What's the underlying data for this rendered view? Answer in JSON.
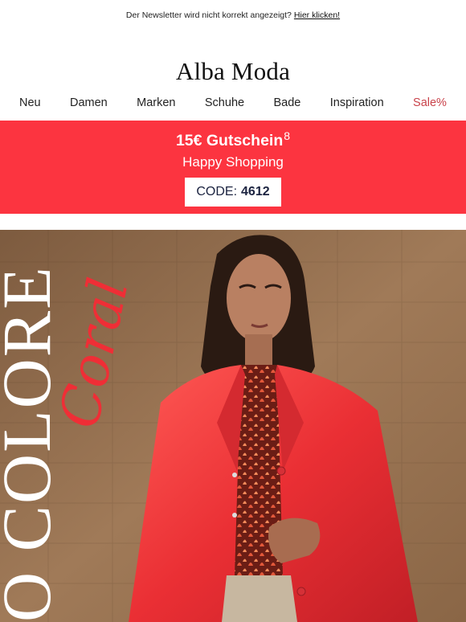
{
  "topbar": {
    "text": "Der Newsletter wird nicht korrekt angezeigt?",
    "link": "Hier klicken!"
  },
  "brand": {
    "logo": "Alba Moda"
  },
  "nav": {
    "items": [
      "Neu",
      "Damen",
      "Marken",
      "Schuhe",
      "Bade",
      "Inspiration",
      "Sale%"
    ]
  },
  "promo": {
    "title": "15€ Gutschein",
    "footnote": "8",
    "subtitle": "Happy Shopping",
    "code_label": "CODE:",
    "code_value": "4612",
    "background": "#fc3440"
  },
  "hero": {
    "vertical_text": "O COLORE",
    "script_text": "Coral",
    "accent": "#ef2e36"
  }
}
